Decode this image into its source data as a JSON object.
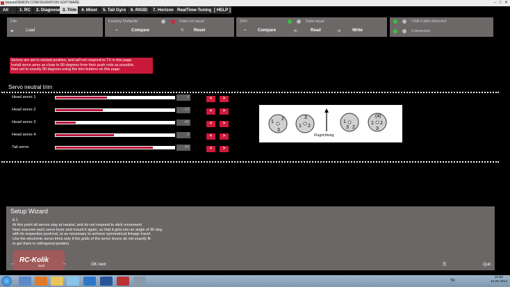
{
  "window": {
    "title": "beaverDEMON CONFIGURATION SOFTWARE",
    "buttons": [
      "–",
      "□",
      "✕"
    ]
  },
  "tabs": [
    {
      "label": "All",
      "active": false
    },
    {
      "label": "1. RC",
      "active": false
    },
    {
      "label": "2. Diagnose",
      "active": false
    },
    {
      "label": "3. Trim",
      "active": true
    },
    {
      "label": "4. Mixer",
      "active": false
    },
    {
      "label": "5. Tail Gyro",
      "active": false
    },
    {
      "label": "6. RIGID",
      "active": false
    },
    {
      "label": "7. Horizon",
      "active": false
    },
    {
      "label": "RealTime-Tuning",
      "active": false
    },
    {
      "label": "[ HELP ]",
      "active": false
    }
  ],
  "file_panel": {
    "title": "File",
    "load_label": "Load",
    "load_icon": "folder-icon"
  },
  "factory_panel": {
    "title": "Factory Defaults",
    "status_text": "Data not equal",
    "compare_label": "Compare",
    "reset_label": "Reset",
    "status_color": "#d4213c"
  },
  "device_panel": {
    "title": "3SX",
    "status_text": "Data equal",
    "compare_label": "Compare",
    "read_label": "Read",
    "write_label": "Write",
    "status_color": "#3fbd3f"
  },
  "usb_panel": {
    "usb_text": "USB-Cable detected",
    "connected_text": "Connected.",
    "status_color": "#3fbd3f"
  },
  "warning": {
    "lines": [
      "Servos are set to neutral position, and will not respond to TX in this page.",
      "Install servo arms as close to 90 degrees from their push rods as possible,",
      "then set to exactly 90 degrees using the trim buttons on this page."
    ]
  },
  "servo_trim": {
    "title": "Servo neutral trim",
    "servos": [
      {
        "label": "Head servo 1",
        "value": "0",
        "fill": 0.43
      },
      {
        "label": "Head servo 2",
        "value": "-12",
        "fill": 0.4
      },
      {
        "label": "Head servo 3",
        "value": "-40",
        "fill": 0.17
      },
      {
        "label": "Head servo 4",
        "value": "0",
        "fill": 0.49
      },
      {
        "label": "Tail servo",
        "value": "60",
        "fill": 0.82
      }
    ],
    "minus_label": "<",
    "plus_label": ">"
  },
  "diagram": {
    "caption": "Flugrichtung"
  },
  "wizard": {
    "title": "Setup Wizard",
    "step": "6.1",
    "lines": [
      "At this point all servos stay at neutral, and do not respond to stick movement.",
      "Now unscrew each servo lever and mount it again, so that it gets into an angle of 90 deg.",
      "with its respective pushrod, or as necessary to acheive symmetrical linkage travel.",
      "Use the electronic servo trims only if the grids of the servo levers do not exactly fit",
      "to get them in orthogonal position."
    ],
    "ok_label": "OK next",
    "quit_label": "Quit",
    "prev_icon": "arrow-left-icon",
    "next_icon": "arrow-right-icon"
  },
  "watermark": {
    "text": "RC-Kolik",
    "sub": "Dark"
  },
  "taskbar": {
    "lang": "TR",
    "time": "20:50",
    "date": "15.06.2013"
  }
}
